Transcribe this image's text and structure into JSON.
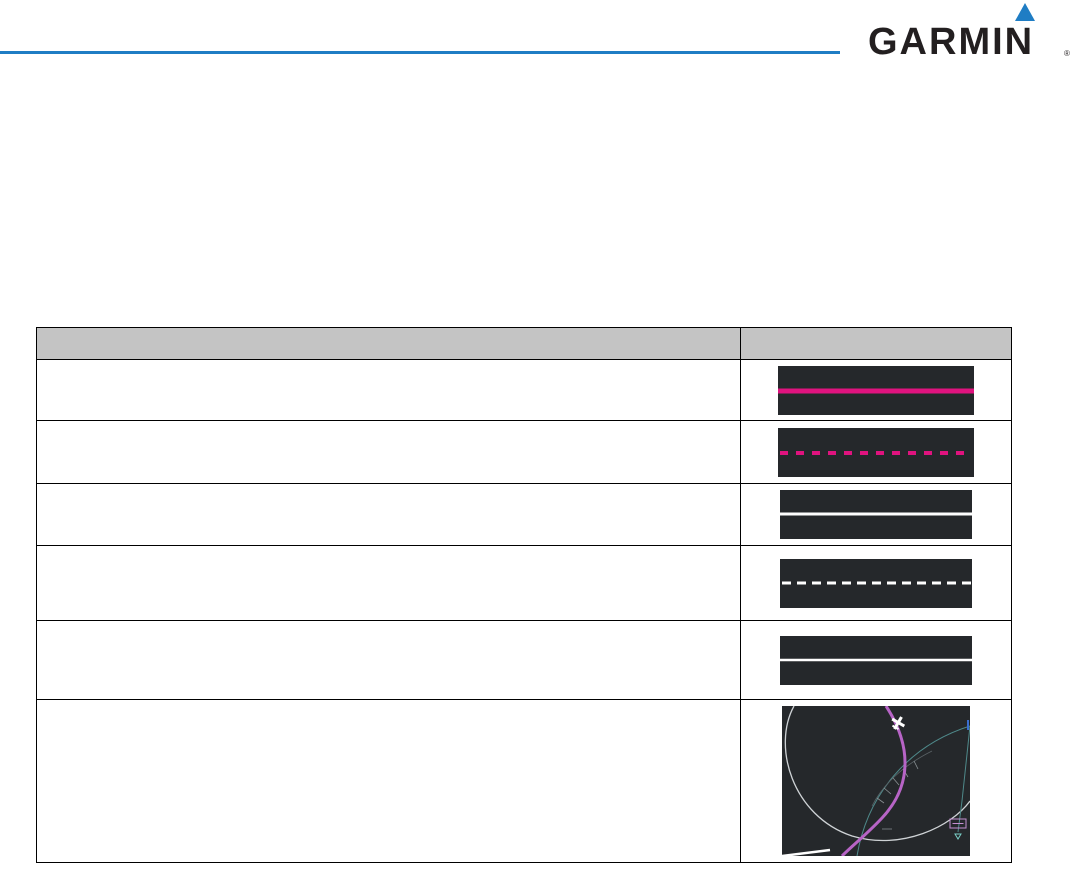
{
  "header": {
    "brand": "GARMIN",
    "registered_mark": "®",
    "colors": {
      "rule": "#1f7dc4",
      "logo_triangle": "#1f7dc4",
      "logo_text": "#231f20"
    }
  },
  "table": {
    "headers": [
      "",
      ""
    ],
    "rows": [
      {
        "description": "",
        "symbol": "magenta-solid-line"
      },
      {
        "description": "",
        "symbol": "magenta-dashed-line"
      },
      {
        "description": "",
        "symbol": "white-solid-line"
      },
      {
        "description": "",
        "symbol": "white-dashed-line"
      },
      {
        "description": "",
        "symbol": "white-solid-line-thin"
      },
      {
        "description": "",
        "symbol": "map-arc-path-illustration"
      }
    ],
    "colors": {
      "header_bg": "#c4c4c4",
      "symbol_bg": "#25282b",
      "magenta": "#e0137f",
      "white": "#f2f2f2",
      "violet_path": "#b764c6",
      "arc": "#cfd3d6",
      "teal": "#4f8a8b"
    }
  }
}
